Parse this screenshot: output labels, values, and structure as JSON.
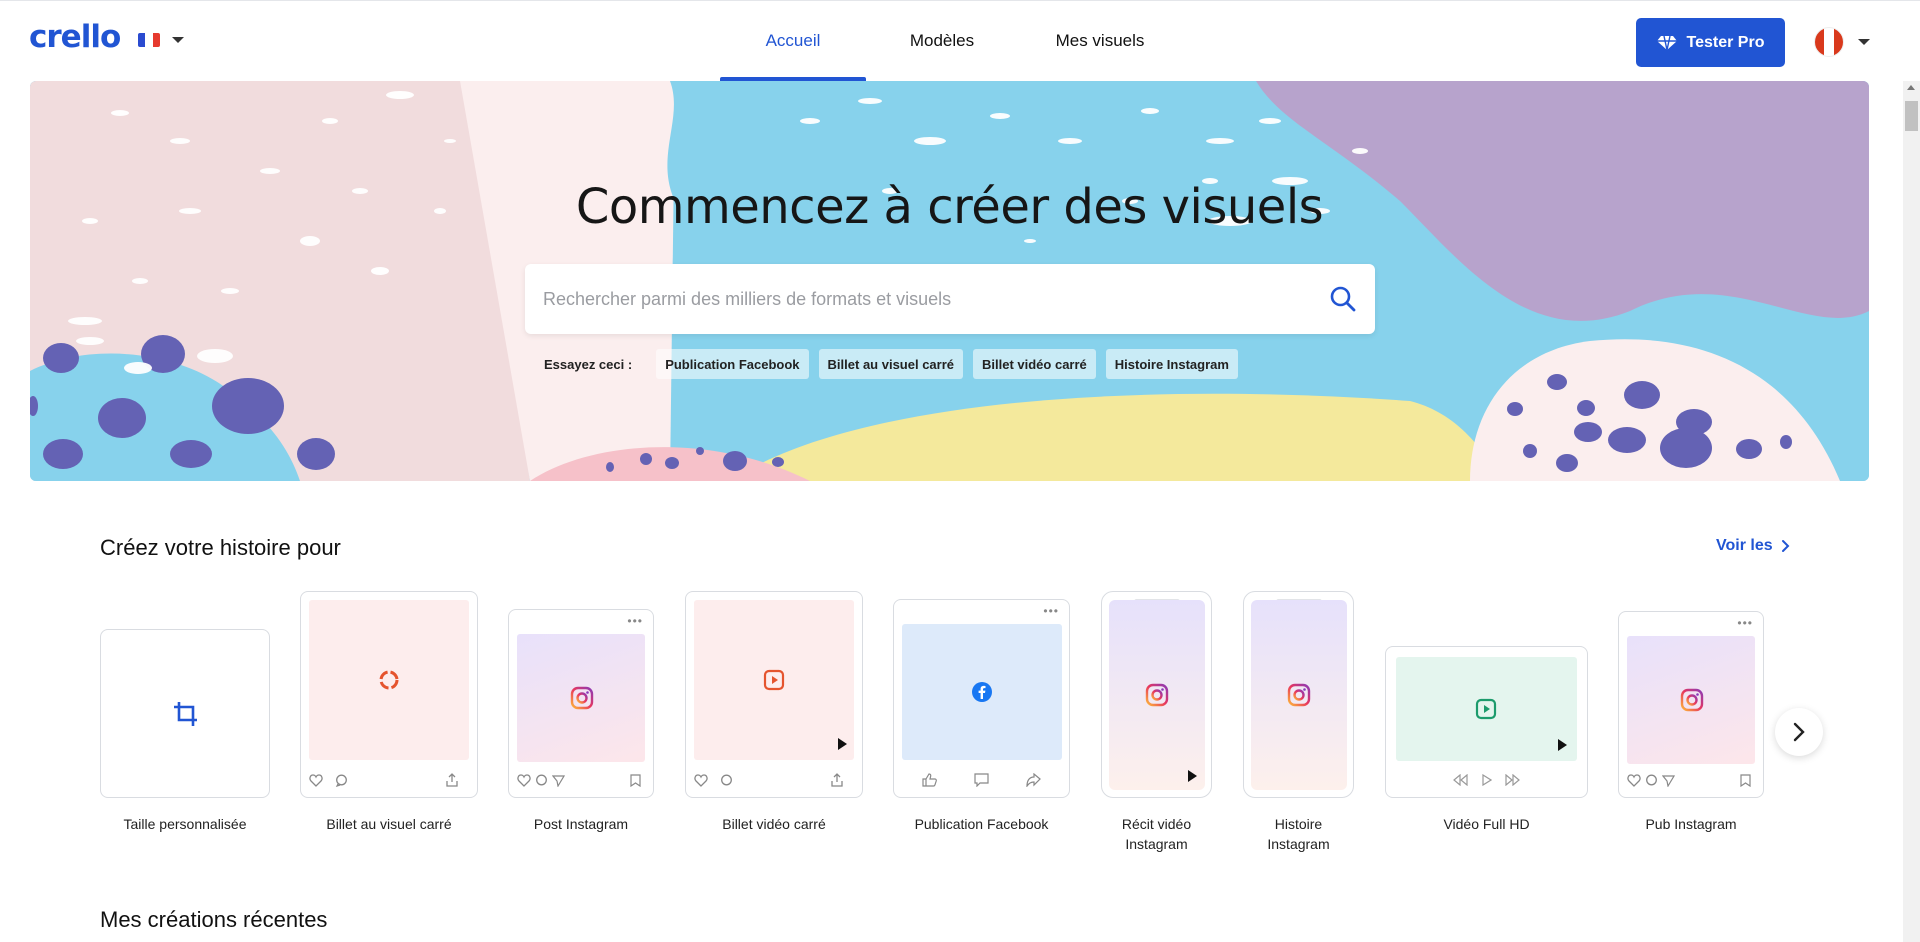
{
  "header": {
    "logo": "crello",
    "language_flag": "flag-fr",
    "nav": [
      {
        "label": "Accueil",
        "active": true
      },
      {
        "label": "Modèles",
        "active": false
      },
      {
        "label": "Mes visuels",
        "active": false
      }
    ],
    "pro_button": "Tester Pro",
    "accent_color": "#2155d3"
  },
  "hero": {
    "title": "Commencez à créer des visuels",
    "search_placeholder": "Rechercher parmi des milliers de formats et visuels",
    "search_value": "",
    "try_label": "Essayez ceci :",
    "suggestions": [
      "Publication Facebook",
      "Billet au visuel carré",
      "Billet vidéo carré",
      "Histoire Instagram"
    ]
  },
  "formats_section": {
    "title": "Créez votre histoire pour",
    "see_all": "Voir les",
    "cards": [
      {
        "label": "Taille personnalisée",
        "icon": "crop-icon"
      },
      {
        "label": "Billet au visuel carré",
        "icon": "crello-icon"
      },
      {
        "label": "Post Instagram",
        "icon": "instagram-icon"
      },
      {
        "label": "Billet vidéo carré",
        "icon": "video-icon"
      },
      {
        "label": "Publication Facebook",
        "icon": "facebook-icon"
      },
      {
        "label": "Récit vidéo Instagram",
        "icon": "instagram-icon"
      },
      {
        "label": "Histoire Instagram",
        "icon": "instagram-icon"
      },
      {
        "label": "Vidéo Full HD",
        "icon": "video-icon"
      },
      {
        "label": "Pub Instagram",
        "icon": "instagram-icon"
      }
    ]
  },
  "recent_section": {
    "title": "Mes créations récentes"
  }
}
